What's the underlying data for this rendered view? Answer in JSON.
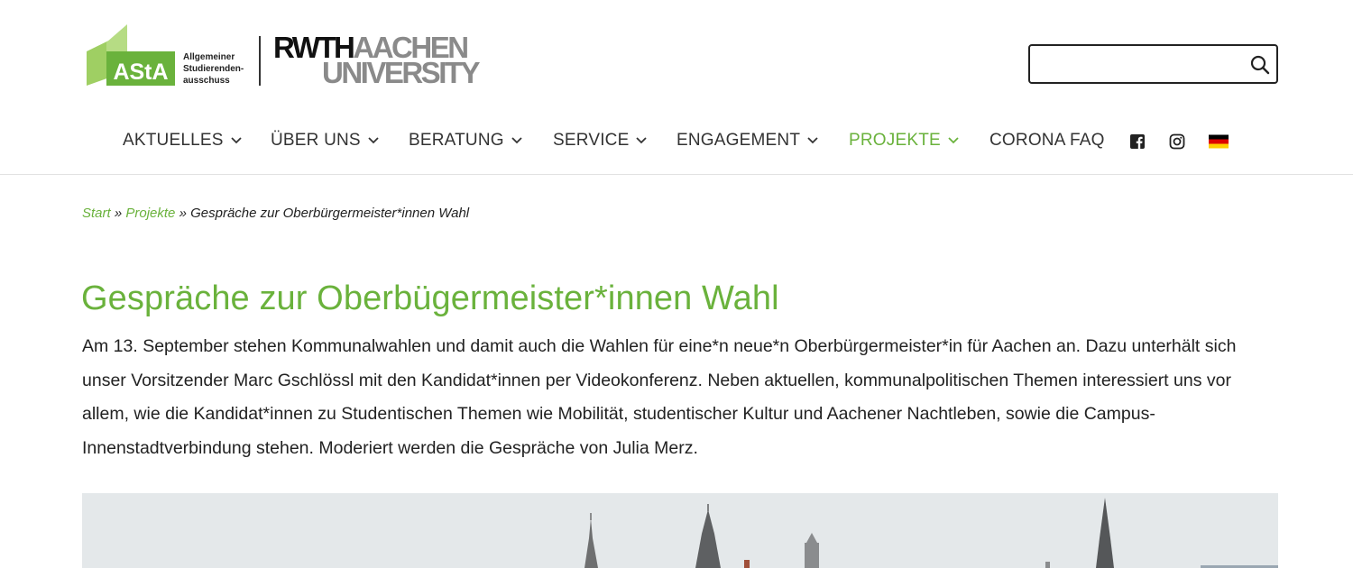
{
  "logo": {
    "asta_text": "AStA",
    "asta_caption": [
      "Allgemeiner",
      "Studierenden-",
      "ausschuss"
    ],
    "rwth_text": "RWTH",
    "aachen_text": "AACHEN",
    "university_text": "UNIVERSITY"
  },
  "search": {
    "value": "",
    "placeholder": ""
  },
  "nav": {
    "items": [
      {
        "label": "AKTUELLES",
        "dropdown": true
      },
      {
        "label": "ÜBER UNS",
        "dropdown": true
      },
      {
        "label": "BERATUNG",
        "dropdown": true
      },
      {
        "label": "SERVICE",
        "dropdown": true
      },
      {
        "label": "ENGAGEMENT",
        "dropdown": true
      },
      {
        "label": "PROJEKTE",
        "dropdown": true,
        "active": true
      },
      {
        "label": "CORONA FAQ",
        "dropdown": false
      }
    ],
    "social": [
      "facebook-icon",
      "instagram-icon",
      "german-flag-icon"
    ]
  },
  "breadcrumb": {
    "items": [
      "Start",
      "Projekte"
    ],
    "separator": "»",
    "current": "Gespräche zur Oberbürgermeister*innen Wahl"
  },
  "page": {
    "title": "Gespräche zur Oberbügermeister*innen Wahl",
    "intro": "Am 13. September stehen Kommunalwahlen und damit auch die Wahlen für eine*n neue*n Oberbürgermeister*in für Aachen an. Dazu unterhält sich unser Vorsitzender Marc Gschlössl mit den Kandidat*innen per Videokonferenz. Neben aktuellen, kommunalpolitischen Themen interessiert uns vor allem, wie die Kandidat*innen zu Studentischen Themen wie Mobilität, studentischer Kultur und Aachener Nachtleben, sowie die Campus-Innenstadtverbindung stehen. Moderiert werden die Gespräche von Julia Merz."
  },
  "colors": {
    "accent": "#6ab23c",
    "asta_green_light": "#8cc63f",
    "rwth_gray": "#8a8a8a",
    "text": "#222222"
  }
}
